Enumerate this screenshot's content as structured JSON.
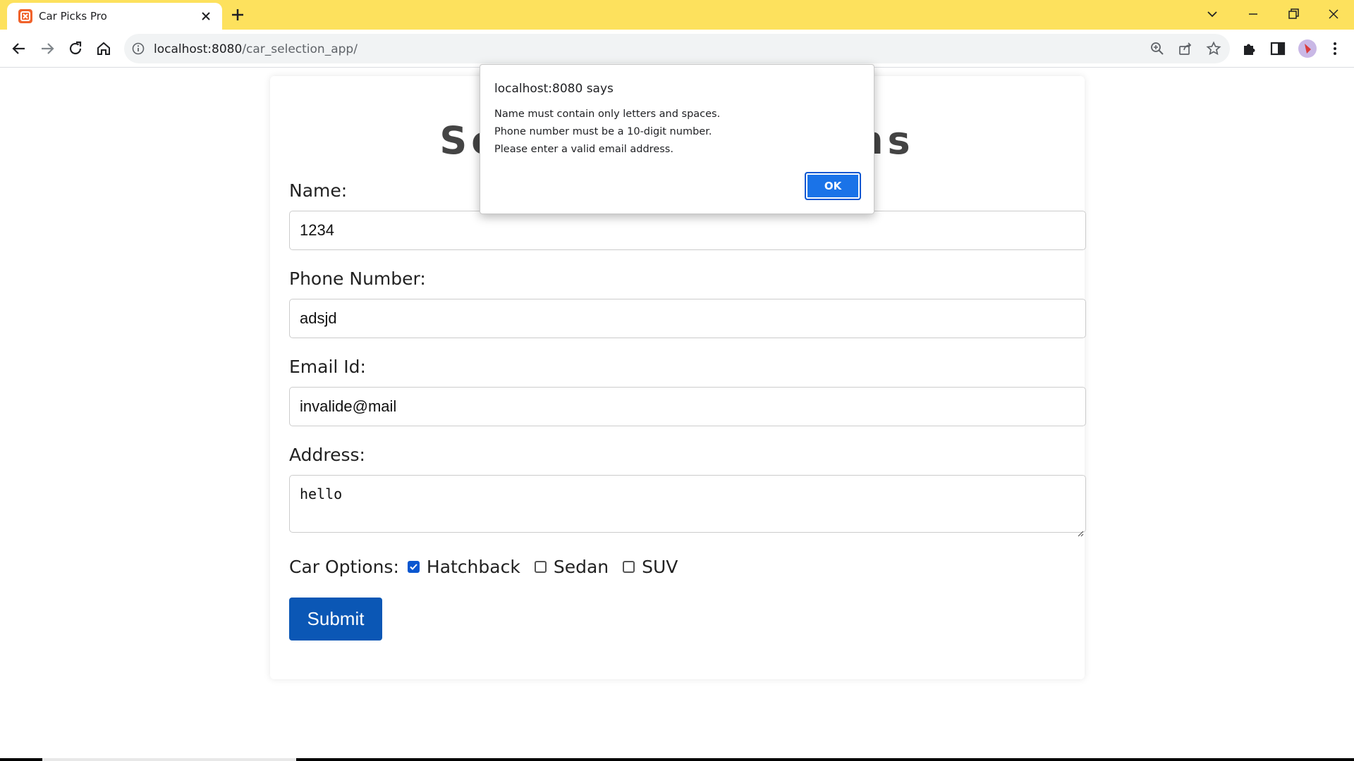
{
  "browser": {
    "tab_title": "Car Picks Pro",
    "url_host": "localhost:8080",
    "url_path": "/car_selection_app/",
    "theme_color": "#fde15d"
  },
  "page": {
    "heading": "Select Car Options",
    "name_label": "Name:",
    "name_value": "1234",
    "phone_label": "Phone Number:",
    "phone_value": "adsjd",
    "email_label": "Email Id:",
    "email_value": "invalide@mail",
    "address_label": "Address:",
    "address_value": "hello",
    "car_options_label": "Car Options:",
    "options": [
      {
        "label": "Hatchback",
        "checked": true
      },
      {
        "label": "Sedan",
        "checked": false
      },
      {
        "label": "SUV",
        "checked": false
      }
    ],
    "submit_label": "Submit",
    "accent_color": "#0b57b5"
  },
  "dialog": {
    "title": "localhost:8080 says",
    "messages": [
      "Name must contain only letters and spaces.",
      "Phone number must be a 10-digit number.",
      "Please enter a valid email address."
    ],
    "ok_label": "OK"
  }
}
